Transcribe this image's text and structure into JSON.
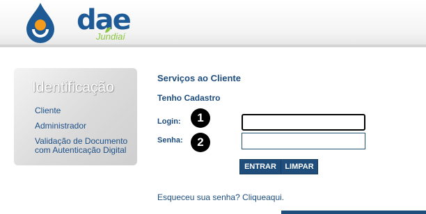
{
  "brand": {
    "name": "dae",
    "city": "Jundiaí"
  },
  "sidebar": {
    "title": "Identificação",
    "items": [
      {
        "label": "Cliente"
      },
      {
        "label": "Administrador"
      },
      {
        "label": "Validação de Documento"
      },
      {
        "label": "com Autenticação Digital"
      }
    ]
  },
  "main": {
    "title": "Serviços ao Cliente",
    "subtitle": "Tenho Cadastro",
    "login_label": "Login:",
    "password_label": "Senha:",
    "login_value": "",
    "password_value": "",
    "badge1": "1",
    "badge2": "2",
    "enter_button": "ENTRAR",
    "clear_button": "LIMPAR",
    "forgot_text": "Esqueceu sua senha? ",
    "forgot_link": "Cliqueaqui."
  },
  "colors": {
    "brand_blue": "#1d5a96",
    "brand_green": "#8cc63f",
    "button": "#1f4e7c"
  }
}
